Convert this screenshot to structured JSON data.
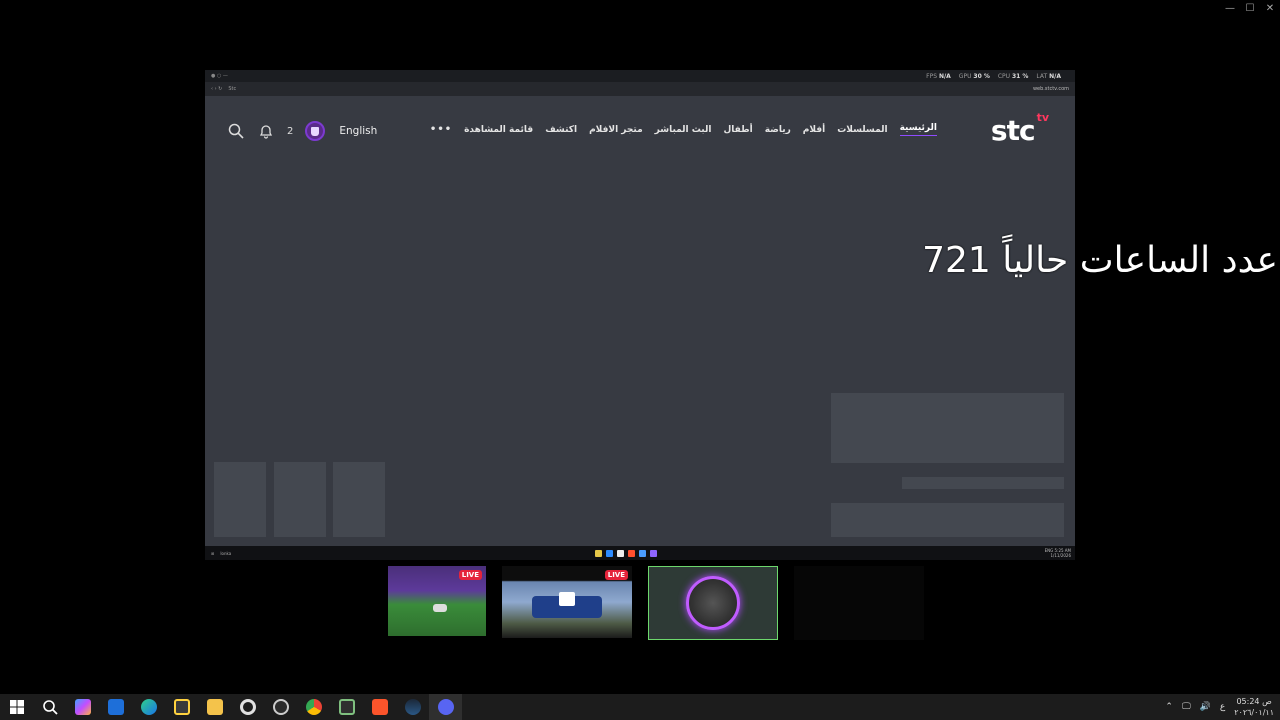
{
  "host_window": {
    "controls": [
      "minimize-icon",
      "maximize-icon",
      "close-icon"
    ]
  },
  "remote_browser": {
    "stats": {
      "fps_label": "FPS",
      "fps_value": "N/A",
      "gpu_label": "GPU",
      "gpu_value": "30 %",
      "cpu_label": "CPU",
      "cpu_value": "31 %",
      "lat_label": "LAT",
      "lat_value": "N/A"
    },
    "address": "Stc",
    "address_right": "web.stctv.com"
  },
  "site": {
    "logo": "stc",
    "logo_sup": "tv",
    "notification_count": "2",
    "language": "English",
    "nav": {
      "more": "•••",
      "watchlist": "قائمة المشاهدة",
      "discover": "اكتشف",
      "movie_store": "متجر الافلام",
      "live": "البث المباشر",
      "kids": "أطفال",
      "sports": "رياضة",
      "movies": "أفلام",
      "series": "المسلسلات",
      "home": "الرئيسية"
    }
  },
  "remote_taskbar": {
    "search": "Ionka",
    "time": "5:25 AM",
    "date": "1/11/2026",
    "lang": "ENG"
  },
  "overlay": {
    "text": "عدد الساعات حالياً 721"
  },
  "thumbnails": [
    {
      "name": "rocket-league",
      "live": "LIVE"
    },
    {
      "name": "driving-game",
      "live": "LIVE"
    },
    {
      "name": "profile-orb",
      "live": ""
    },
    {
      "name": "dark-stream",
      "live": ""
    }
  ],
  "taskbar": {
    "icons": [
      "windows-start-icon",
      "search-icon",
      "copilot-icon",
      "outlook-icon",
      "edge-icon",
      "store-icon",
      "file-explorer-icon",
      "settings-icon",
      "obs-icon",
      "chrome-icon",
      "xbox-icon",
      "brave-icon",
      "steam-icon",
      "discord-icon"
    ],
    "tray_lang": "ع",
    "time": "05:24 ص",
    "date": "٢٠٢٦/٠١/١١",
    "accent": "#c05cff"
  }
}
